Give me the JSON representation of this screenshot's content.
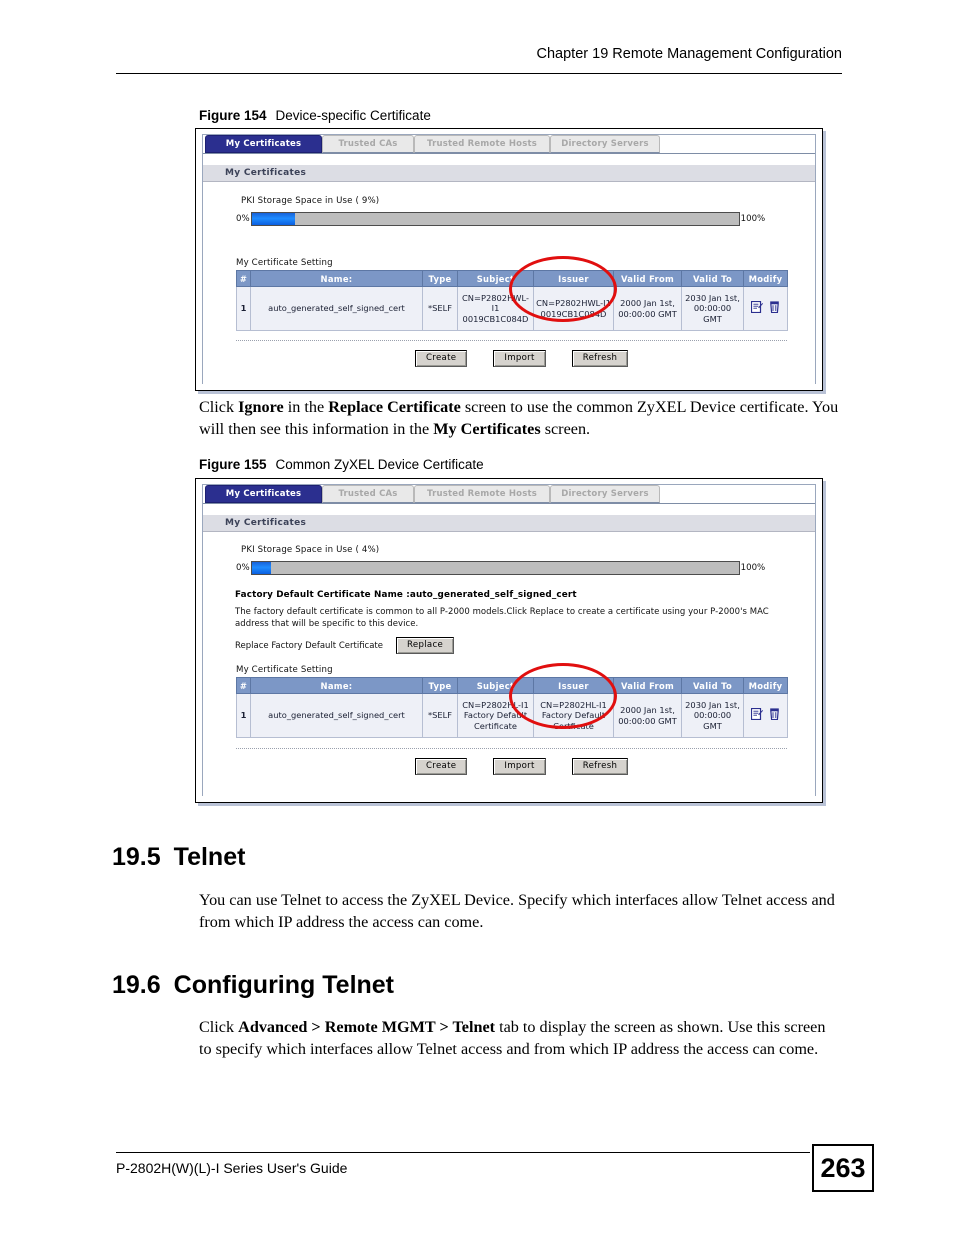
{
  "page": {
    "running_header": "Chapter 19 Remote Management Configuration",
    "footer_text": "P-2802H(W)(L)-I Series User's Guide",
    "page_number": "263"
  },
  "figure154": {
    "caption_number": "Figure 154",
    "caption_title": "Device-specific Certificate",
    "tabs": [
      {
        "label": "My Certificates",
        "state": "active"
      },
      {
        "label": "Trusted CAs",
        "state": "inactive"
      },
      {
        "label": "Trusted Remote Hosts",
        "state": "inactive"
      },
      {
        "label": "Directory Servers",
        "state": "inactive"
      }
    ],
    "section_bar": "My Certificates",
    "pki": {
      "label": "PKI Storage Space in Use ( 9%)",
      "min_label": "0%",
      "max_label": "100%",
      "percent": 9
    },
    "table_title": "My Certificate Setting",
    "table": {
      "headers": [
        "#",
        "Name:",
        "Type",
        "Subject",
        "Issuer",
        "Valid From",
        "Valid To",
        "Modify"
      ],
      "rows": [
        {
          "index": "1",
          "name": "auto_generated_self_signed_cert",
          "type": "*SELF",
          "subject": "CN=P2802HWL-I1 0019CB1C084D",
          "issuer": "CN=P2802HWL-I1 0019CB1C084D",
          "valid_from": "2000 Jan 1st, 00:00:00 GMT",
          "valid_to": "2030 Jan 1st, 00:00:00 GMT"
        }
      ]
    },
    "buttons": [
      "Create",
      "Import",
      "Refresh"
    ],
    "annotation": "red-ellipse-around-issuer-column"
  },
  "paragraph_after_154": {
    "html": "Click <b>Ignore</b> in the <b>Replace Certificate</b> screen to use the common ZyXEL Device certificate. You will then see this information in the <b>My Certificates</b> screen."
  },
  "figure155": {
    "caption_number": "Figure 155",
    "caption_title": "Common ZyXEL Device Certificate",
    "tabs": [
      {
        "label": "My Certificates",
        "state": "active"
      },
      {
        "label": "Trusted CAs",
        "state": "inactive"
      },
      {
        "label": "Trusted Remote Hosts",
        "state": "inactive"
      },
      {
        "label": "Directory Servers",
        "state": "inactive"
      }
    ],
    "section_bar": "My Certificates",
    "pki": {
      "label": "PKI Storage Space in Use ( 4%)",
      "min_label": "0%",
      "max_label": "100%",
      "percent": 4
    },
    "factory_default": {
      "title": "Factory Default Certificate Name :auto_generated_self_signed_cert",
      "description": "The factory default certificate is common to all P-2000 models.Click Replace to create a certificate using your P-2000's MAC address that will be specific to this device.",
      "replace_label": "Replace Factory Default Certificate",
      "replace_button": "Replace"
    },
    "table_title": "My Certificate Setting",
    "table": {
      "headers": [
        "#",
        "Name:",
        "Type",
        "Subject",
        "Issuer",
        "Valid From",
        "Valid To",
        "Modify"
      ],
      "rows": [
        {
          "index": "1",
          "name": "auto_generated_self_signed_cert",
          "type": "*SELF",
          "subject": "CN=P2802HL-I1 Factory Default Certificate",
          "issuer": "CN=P2802HL-I1 Factory Default Certficate",
          "valid_from": "2000 Jan 1st, 00:00:00 GMT",
          "valid_to": "2030 Jan 1st, 00:00:00 GMT"
        }
      ]
    },
    "buttons": [
      "Create",
      "Import",
      "Refresh"
    ],
    "annotation": "red-ellipse-around-issuer-column"
  },
  "section_19_5": {
    "number": "19.5",
    "title": "Telnet",
    "body": "You can use Telnet to access the ZyXEL Device. Specify which interfaces allow Telnet access and from which IP address the access can come."
  },
  "section_19_6": {
    "number": "19.6",
    "title": "Configuring Telnet",
    "body_html": "Click <b>Advanced &gt; Remote MGMT &gt; Telnet</b> tab to display the screen as shown. Use this screen to specify which interfaces allow Telnet access and from which IP address the access can come."
  },
  "icons": {
    "edit": "edit-certificate-icon",
    "delete": "delete-certificate-icon"
  },
  "colors": {
    "tab_active_bg": "#2b2f8f",
    "table_header_bg": "#7c97c6",
    "progress_fill": "#1f8cff",
    "annotation_red": "#e10f0f"
  }
}
